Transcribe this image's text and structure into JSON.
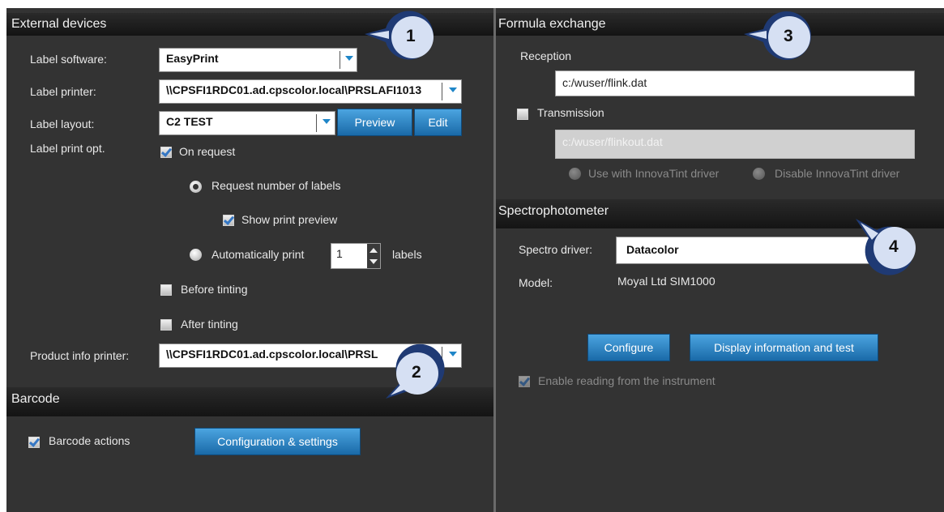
{
  "colors": {
    "panel_bg": "#333333",
    "header_bg": "#161616",
    "accent": "#1f86c8",
    "button": "#2b85c8",
    "callout_fill": "#d6e0f3",
    "callout_border": "#1f3a74"
  },
  "external": {
    "title": "External devices",
    "label_software": {
      "label": "Label software:",
      "value": "EasyPrint"
    },
    "label_printer": {
      "label": "Label printer:",
      "value": "\\\\CPSFI1RDC01.ad.cpscolor.local\\PRSLAFI1013"
    },
    "label_layout": {
      "label": "Label layout:",
      "value": "C2 TEST",
      "preview": "Preview",
      "edit": "Edit"
    },
    "label_print_opt": {
      "label": "Label print opt.",
      "on_request": "On request",
      "request_number": "Request number of labels",
      "show_preview": "Show print preview",
      "auto_print": "Automatically print",
      "auto_count": "1",
      "labels_suffix": "labels",
      "before_tinting": "Before tinting",
      "after_tinting": "After tinting"
    },
    "product_printer": {
      "label": "Product info printer:",
      "value": "\\\\CPSFI1RDC01.ad.cpscolor.local\\PRSL"
    }
  },
  "barcode": {
    "title": "Barcode",
    "actions": "Barcode actions",
    "config_button": "Configuration & settings"
  },
  "formula": {
    "title": "Formula exchange",
    "reception_label": "Reception",
    "reception_value": "c:/wuser/flink.dat",
    "transmission_label": "Transmission",
    "transmission_value": "c:/wuser/flinkout.dat",
    "use_innovatint": "Use with InnovaTint driver",
    "disable_innovatint": "Disable InnovaTint driver"
  },
  "spectro": {
    "title": "Spectrophotometer",
    "driver_label": "Spectro driver:",
    "driver_value": "Datacolor",
    "model_label": "Model:",
    "model_value": "Moyal Ltd SIM1000",
    "configure": "Configure",
    "display_info": "Display information and test",
    "enable_reading": "Enable reading from the instrument"
  },
  "callouts": [
    "1",
    "2",
    "3",
    "4"
  ]
}
